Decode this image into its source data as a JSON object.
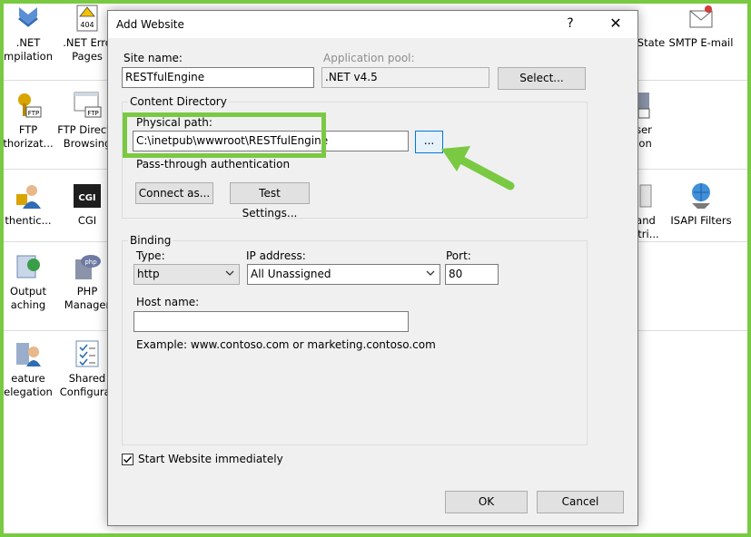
{
  "background": {
    "items": [
      {
        "name": "net-compilation",
        "line1": ".NET",
        "line2": "mpilation"
      },
      {
        "name": "net-error-pages",
        "line1": ".NET Erro",
        "line2": "Pages"
      },
      {
        "name": "ftp-authorization",
        "line1": "FTP",
        "line2": "thorizat..."
      },
      {
        "name": "ftp-directory-browsing",
        "line1": "FTP Directo",
        "line2": "Browsing"
      },
      {
        "name": "authentication",
        "line1": "thentic...",
        "line2": ""
      },
      {
        "name": "cgi",
        "line1": "CGI",
        "line2": ""
      },
      {
        "name": "output-caching",
        "line1": "Output",
        "line2": "aching"
      },
      {
        "name": "php-manager",
        "line1": "PHP",
        "line2": "Manager"
      },
      {
        "name": "feature-delegation",
        "line1": "eature",
        "line2": "elegation"
      },
      {
        "name": "shared-configuration",
        "line1": "Shared",
        "line2": "Configurat"
      },
      {
        "name": "state",
        "line1": "State",
        "line2": ""
      },
      {
        "name": "smtp-email",
        "line1": "SMTP E-mail",
        "line2": ""
      },
      {
        "name": "user-ion",
        "line1": "ser",
        "line2": "ion"
      },
      {
        "name": "and-tri",
        "line1": "and",
        "line2": "stri..."
      },
      {
        "name": "isapi-filters",
        "line1": "ISAPI Filters",
        "line2": ""
      }
    ],
    "icon_labels": {
      "error": "404",
      "cgi": "CGI",
      "php": "php",
      "ftp": "FTP"
    }
  },
  "dialog": {
    "title": "Add Website",
    "help": "?",
    "close": "✕",
    "site_name_label": "Site name:",
    "site_name_value": "RESTfulEngine",
    "app_pool_label": "Application pool:",
    "app_pool_value": ".NET v4.5",
    "select_button": "Select...",
    "content_directory": {
      "title": "Content Directory",
      "physical_path_label": "Physical path:",
      "physical_path_value": "C:\\inetpub\\wwwroot\\RESTfulEngine",
      "browse_button": "...",
      "pass_through_label": "Pass-through authentication",
      "connect_as_button": "Connect as...",
      "test_settings_button": "Test Settings..."
    },
    "binding": {
      "title": "Binding",
      "type_label": "Type:",
      "type_value": "http",
      "ip_label": "IP address:",
      "ip_value": "All Unassigned",
      "port_label": "Port:",
      "port_value": "80",
      "host_label": "Host name:",
      "host_value": "",
      "example": "Example: www.contoso.com or marketing.contoso.com"
    },
    "start_immediately_label": "Start Website immediately",
    "start_immediately_checked": true,
    "ok_button": "OK",
    "cancel_button": "Cancel"
  },
  "colors": {
    "highlight": "#7ac943",
    "focus": "#0078d7"
  }
}
